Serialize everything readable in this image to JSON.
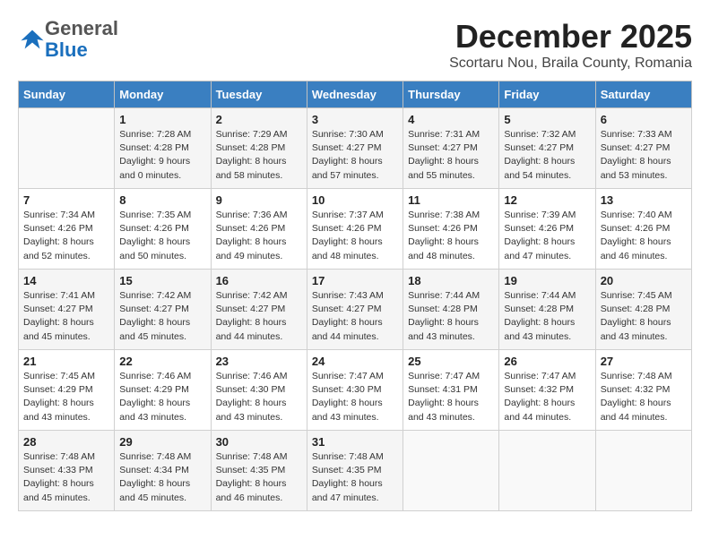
{
  "header": {
    "logo_general": "General",
    "logo_blue": "Blue",
    "month_title": "December 2025",
    "location": "Scortaru Nou, Braila County, Romania"
  },
  "weekdays": [
    "Sunday",
    "Monday",
    "Tuesday",
    "Wednesday",
    "Thursday",
    "Friday",
    "Saturday"
  ],
  "weeks": [
    [
      {
        "day": "",
        "info": ""
      },
      {
        "day": "1",
        "info": "Sunrise: 7:28 AM\nSunset: 4:28 PM\nDaylight: 9 hours\nand 0 minutes."
      },
      {
        "day": "2",
        "info": "Sunrise: 7:29 AM\nSunset: 4:28 PM\nDaylight: 8 hours\nand 58 minutes."
      },
      {
        "day": "3",
        "info": "Sunrise: 7:30 AM\nSunset: 4:27 PM\nDaylight: 8 hours\nand 57 minutes."
      },
      {
        "day": "4",
        "info": "Sunrise: 7:31 AM\nSunset: 4:27 PM\nDaylight: 8 hours\nand 55 minutes."
      },
      {
        "day": "5",
        "info": "Sunrise: 7:32 AM\nSunset: 4:27 PM\nDaylight: 8 hours\nand 54 minutes."
      },
      {
        "day": "6",
        "info": "Sunrise: 7:33 AM\nSunset: 4:27 PM\nDaylight: 8 hours\nand 53 minutes."
      }
    ],
    [
      {
        "day": "7",
        "info": "Sunrise: 7:34 AM\nSunset: 4:26 PM\nDaylight: 8 hours\nand 52 minutes."
      },
      {
        "day": "8",
        "info": "Sunrise: 7:35 AM\nSunset: 4:26 PM\nDaylight: 8 hours\nand 50 minutes."
      },
      {
        "day": "9",
        "info": "Sunrise: 7:36 AM\nSunset: 4:26 PM\nDaylight: 8 hours\nand 49 minutes."
      },
      {
        "day": "10",
        "info": "Sunrise: 7:37 AM\nSunset: 4:26 PM\nDaylight: 8 hours\nand 48 minutes."
      },
      {
        "day": "11",
        "info": "Sunrise: 7:38 AM\nSunset: 4:26 PM\nDaylight: 8 hours\nand 48 minutes."
      },
      {
        "day": "12",
        "info": "Sunrise: 7:39 AM\nSunset: 4:26 PM\nDaylight: 8 hours\nand 47 minutes."
      },
      {
        "day": "13",
        "info": "Sunrise: 7:40 AM\nSunset: 4:26 PM\nDaylight: 8 hours\nand 46 minutes."
      }
    ],
    [
      {
        "day": "14",
        "info": "Sunrise: 7:41 AM\nSunset: 4:27 PM\nDaylight: 8 hours\nand 45 minutes."
      },
      {
        "day": "15",
        "info": "Sunrise: 7:42 AM\nSunset: 4:27 PM\nDaylight: 8 hours\nand 45 minutes."
      },
      {
        "day": "16",
        "info": "Sunrise: 7:42 AM\nSunset: 4:27 PM\nDaylight: 8 hours\nand 44 minutes."
      },
      {
        "day": "17",
        "info": "Sunrise: 7:43 AM\nSunset: 4:27 PM\nDaylight: 8 hours\nand 44 minutes."
      },
      {
        "day": "18",
        "info": "Sunrise: 7:44 AM\nSunset: 4:28 PM\nDaylight: 8 hours\nand 43 minutes."
      },
      {
        "day": "19",
        "info": "Sunrise: 7:44 AM\nSunset: 4:28 PM\nDaylight: 8 hours\nand 43 minutes."
      },
      {
        "day": "20",
        "info": "Sunrise: 7:45 AM\nSunset: 4:28 PM\nDaylight: 8 hours\nand 43 minutes."
      }
    ],
    [
      {
        "day": "21",
        "info": "Sunrise: 7:45 AM\nSunset: 4:29 PM\nDaylight: 8 hours\nand 43 minutes."
      },
      {
        "day": "22",
        "info": "Sunrise: 7:46 AM\nSunset: 4:29 PM\nDaylight: 8 hours\nand 43 minutes."
      },
      {
        "day": "23",
        "info": "Sunrise: 7:46 AM\nSunset: 4:30 PM\nDaylight: 8 hours\nand 43 minutes."
      },
      {
        "day": "24",
        "info": "Sunrise: 7:47 AM\nSunset: 4:30 PM\nDaylight: 8 hours\nand 43 minutes."
      },
      {
        "day": "25",
        "info": "Sunrise: 7:47 AM\nSunset: 4:31 PM\nDaylight: 8 hours\nand 43 minutes."
      },
      {
        "day": "26",
        "info": "Sunrise: 7:47 AM\nSunset: 4:32 PM\nDaylight: 8 hours\nand 44 minutes."
      },
      {
        "day": "27",
        "info": "Sunrise: 7:48 AM\nSunset: 4:32 PM\nDaylight: 8 hours\nand 44 minutes."
      }
    ],
    [
      {
        "day": "28",
        "info": "Sunrise: 7:48 AM\nSunset: 4:33 PM\nDaylight: 8 hours\nand 45 minutes."
      },
      {
        "day": "29",
        "info": "Sunrise: 7:48 AM\nSunset: 4:34 PM\nDaylight: 8 hours\nand 45 minutes."
      },
      {
        "day": "30",
        "info": "Sunrise: 7:48 AM\nSunset: 4:35 PM\nDaylight: 8 hours\nand 46 minutes."
      },
      {
        "day": "31",
        "info": "Sunrise: 7:48 AM\nSunset: 4:35 PM\nDaylight: 8 hours\nand 47 minutes."
      },
      {
        "day": "",
        "info": ""
      },
      {
        "day": "",
        "info": ""
      },
      {
        "day": "",
        "info": ""
      }
    ]
  ]
}
